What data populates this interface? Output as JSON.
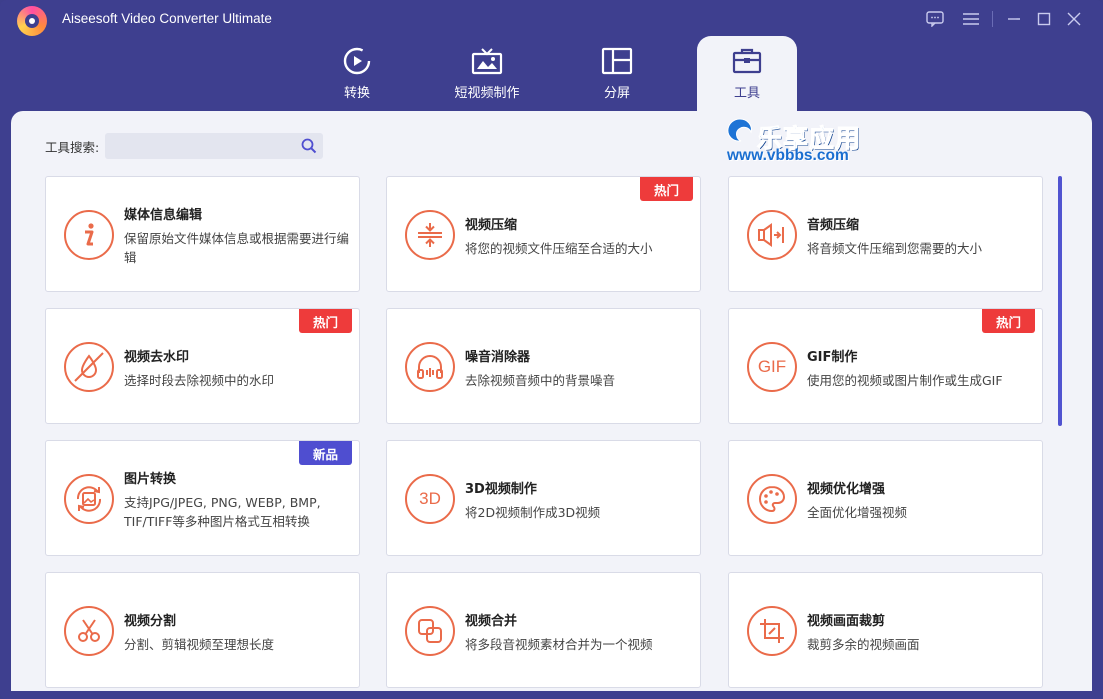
{
  "app": {
    "title": "Aiseesoft Video Converter Ultimate"
  },
  "tabs": [
    {
      "label": "转换",
      "icon": "convert-icon",
      "active": false
    },
    {
      "label": "短视频制作",
      "icon": "short-video-icon",
      "active": false
    },
    {
      "label": "分屏",
      "icon": "split-screen-icon",
      "active": false
    },
    {
      "label": "工具",
      "icon": "toolbox-icon",
      "active": true
    }
  ],
  "search": {
    "label": "工具搜索:",
    "value": "",
    "placeholder": ""
  },
  "watermark": {
    "top": "乐享应用",
    "bottom": "www.vbbbs.com"
  },
  "tools": [
    {
      "title": "媒体信息编辑",
      "desc": "保留原始文件媒体信息或根据需要进行编辑",
      "icon": "info-icon",
      "badge": ""
    },
    {
      "title": "视频压缩",
      "desc": "将您的视频文件压缩至合适的大小",
      "icon": "compress-icon",
      "badge": "热门"
    },
    {
      "title": "音频压缩",
      "desc": "将音频文件压缩到您需要的大小",
      "icon": "audio-compress-icon",
      "badge": ""
    },
    {
      "title": "视频去水印",
      "desc": "选择时段去除视频中的水印",
      "icon": "watermark-remove-icon",
      "badge": "热门"
    },
    {
      "title": "噪音消除器",
      "desc": "去除视频音频中的背景噪音",
      "icon": "headphones-icon",
      "badge": ""
    },
    {
      "title": "GIF制作",
      "desc": "使用您的视频或图片制作或生成GIF",
      "icon": "gif-icon",
      "badge": "热门"
    },
    {
      "title": "图片转换",
      "desc": "支持JPG/JPEG, PNG, WEBP, BMP, TIF/TIFF等多种图片格式互相转换",
      "icon": "image-convert-icon",
      "badge": "新品"
    },
    {
      "title": "3D视频制作",
      "desc": "将2D视频制作成3D视频",
      "icon": "3d-icon",
      "badge": ""
    },
    {
      "title": "视频优化增强",
      "desc": "全面优化增强视频",
      "icon": "palette-icon",
      "badge": ""
    },
    {
      "title": "视频分割",
      "desc": "分割、剪辑视频至理想长度",
      "icon": "scissors-icon",
      "badge": ""
    },
    {
      "title": "视频合并",
      "desc": "将多段音视频素材合并为一个视频",
      "icon": "merge-icon",
      "badge": ""
    },
    {
      "title": "视频画面裁剪",
      "desc": "裁剪多余的视频画面",
      "icon": "crop-icon",
      "badge": ""
    }
  ],
  "colors": {
    "frame": "#3e3f8f",
    "accent": "#ea6b4a",
    "hot": "#ee3b3b",
    "new": "#4f4ed0",
    "panel": "#f2f3f9"
  }
}
